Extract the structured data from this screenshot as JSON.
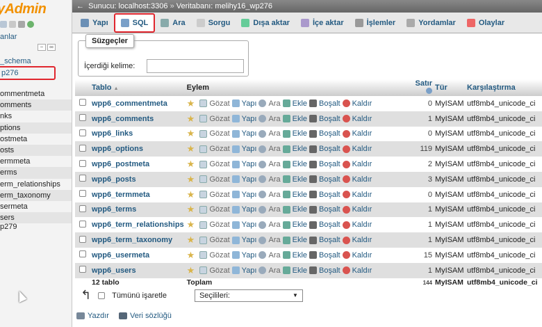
{
  "left_panel": {
    "logo_text": "yAdmin",
    "recent_label": "anlar",
    "databases": {
      "schema": "_schema",
      "selected": "p276",
      "other": "p279"
    },
    "tables": [
      "ommentmeta",
      "omments",
      "nks",
      "ptions",
      "ostmeta",
      "osts",
      "ermmeta",
      "erms",
      "erm_relationships",
      "erm_taxonomy",
      "sermeta",
      "sers"
    ]
  },
  "breadcrumb": {
    "server": "Sunucu: localhost:3306",
    "separator": "»",
    "database": "Veritabanı: melihy16_wp276"
  },
  "tabs": [
    {
      "label": "Yapı",
      "icon": "structure-icon",
      "color": "#6b8fb5"
    },
    {
      "label": "SQL",
      "icon": "sql-icon",
      "color": "#7aa0c8"
    },
    {
      "label": "Ara",
      "icon": "search-icon",
      "color": "#8aa"
    },
    {
      "label": "Sorgu",
      "icon": "query-icon",
      "color": "#ccc"
    },
    {
      "label": "Dışa aktar",
      "icon": "export-icon",
      "color": "#6c9"
    },
    {
      "label": "İçe aktar",
      "icon": "import-icon",
      "color": "#a9c"
    },
    {
      "label": "İşlemler",
      "icon": "wrench-icon",
      "color": "#999"
    },
    {
      "label": "Yordamlar",
      "icon": "routines-icon",
      "color": "#aaa"
    },
    {
      "label": "Olaylar",
      "icon": "clock-icon",
      "color": "#e66"
    }
  ],
  "filters": {
    "legend": "Süzgeçler",
    "label": "İçerdiği kelime:",
    "value": ""
  },
  "table": {
    "headers": {
      "table": "Tablo",
      "sort": "▲",
      "action": "Eylem",
      "rows": "Satır",
      "type": "Tür",
      "collation": "Karşılaştırma"
    },
    "actions": {
      "browse": "Gözat",
      "structure": "Yapı",
      "search": "Ara",
      "insert": "Ekle",
      "empty": "Boşalt",
      "drop": "Kaldır"
    },
    "rows": [
      {
        "name": "wpp6_commentmeta",
        "rows": "0",
        "type": "MyISAM",
        "collation": "utf8mb4_unicode_ci"
      },
      {
        "name": "wpp6_comments",
        "rows": "1",
        "type": "MyISAM",
        "collation": "utf8mb4_unicode_ci"
      },
      {
        "name": "wpp6_links",
        "rows": "0",
        "type": "MyISAM",
        "collation": "utf8mb4_unicode_ci"
      },
      {
        "name": "wpp6_options",
        "rows": "119",
        "type": "MyISAM",
        "collation": "utf8mb4_unicode_ci"
      },
      {
        "name": "wpp6_postmeta",
        "rows": "2",
        "type": "MyISAM",
        "collation": "utf8mb4_unicode_ci"
      },
      {
        "name": "wpp6_posts",
        "rows": "3",
        "type": "MyISAM",
        "collation": "utf8mb4_unicode_ci"
      },
      {
        "name": "wpp6_termmeta",
        "rows": "0",
        "type": "MyISAM",
        "collation": "utf8mb4_unicode_ci"
      },
      {
        "name": "wpp6_terms",
        "rows": "1",
        "type": "MyISAM",
        "collation": "utf8mb4_unicode_ci"
      },
      {
        "name": "wpp6_term_relationships",
        "rows": "1",
        "type": "MyISAM",
        "collation": "utf8mb4_unicode_ci"
      },
      {
        "name": "wpp6_term_taxonomy",
        "rows": "1",
        "type": "MyISAM",
        "collation": "utf8mb4_unicode_ci"
      },
      {
        "name": "wpp6_usermeta",
        "rows": "15",
        "type": "MyISAM",
        "collation": "utf8mb4_unicode_ci"
      },
      {
        "name": "wpp6_users",
        "rows": "1",
        "type": "MyISAM",
        "collation": "utf8mb4_unicode_ci"
      }
    ],
    "footer": {
      "count": "12 tablo",
      "total_label": "Toplam",
      "total_rows": "144",
      "type": "MyISAM",
      "collation": "utf8mb4_unicode_ci"
    }
  },
  "bottom": {
    "check_all": "Tümünü işaretle",
    "with_selected": "Seçilileri:"
  },
  "links": {
    "print": "Yazdır",
    "dictionary": "Veri sözlüğü"
  }
}
